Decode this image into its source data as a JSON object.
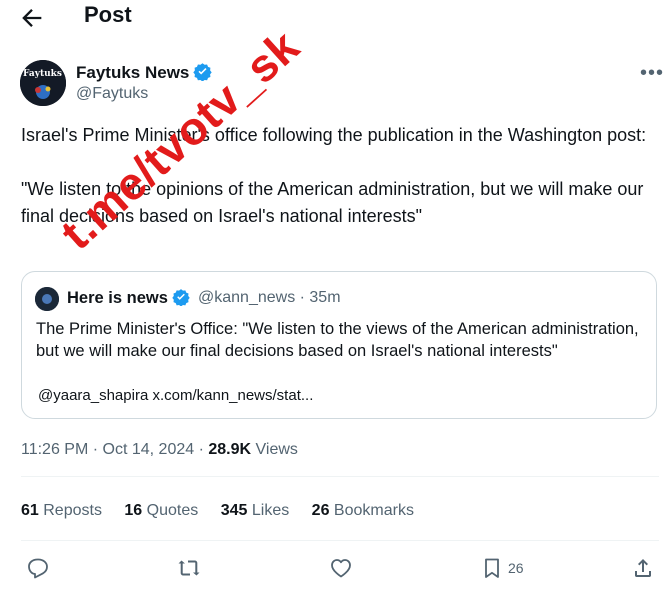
{
  "header": {
    "title": "Post"
  },
  "tweet": {
    "author_name": "Faytuks News",
    "author_handle": "@Faytuks",
    "avatar_text": "Faytuks",
    "text": "Israel's Prime Minister's office following the publication in the Washington post:\n\n\"We listen to the opinions of the American administration, but we will make our final decisions based on Israel's national interests\"",
    "time": "11:26 PM",
    "date": "Oct 14, 2024",
    "views_count": "28.9K",
    "views_label": "Views"
  },
  "quote": {
    "author_name": "Here is news",
    "author_handle": "@kann_news",
    "age": "35m",
    "text": "The Prime Minister's Office: \"We listen to the views of the American administration, but we will make our final decisions based on Israel's national interests\"",
    "link": "@yaara_shapira x.com/kann_news/stat..."
  },
  "stats": {
    "reposts_count": "61",
    "reposts_label": "Reposts",
    "quotes_count": "16",
    "quotes_label": "Quotes",
    "likes_count": "345",
    "likes_label": "Likes",
    "bookmarks_count": "26",
    "bookmarks_label": "Bookmarks"
  },
  "actions": {
    "bookmark_count": "26"
  },
  "watermark": "t.me/tvotv_sk",
  "colors": {
    "verified": "#1d9bf0",
    "watermark": "#e21b1b",
    "muted": "#536471"
  }
}
